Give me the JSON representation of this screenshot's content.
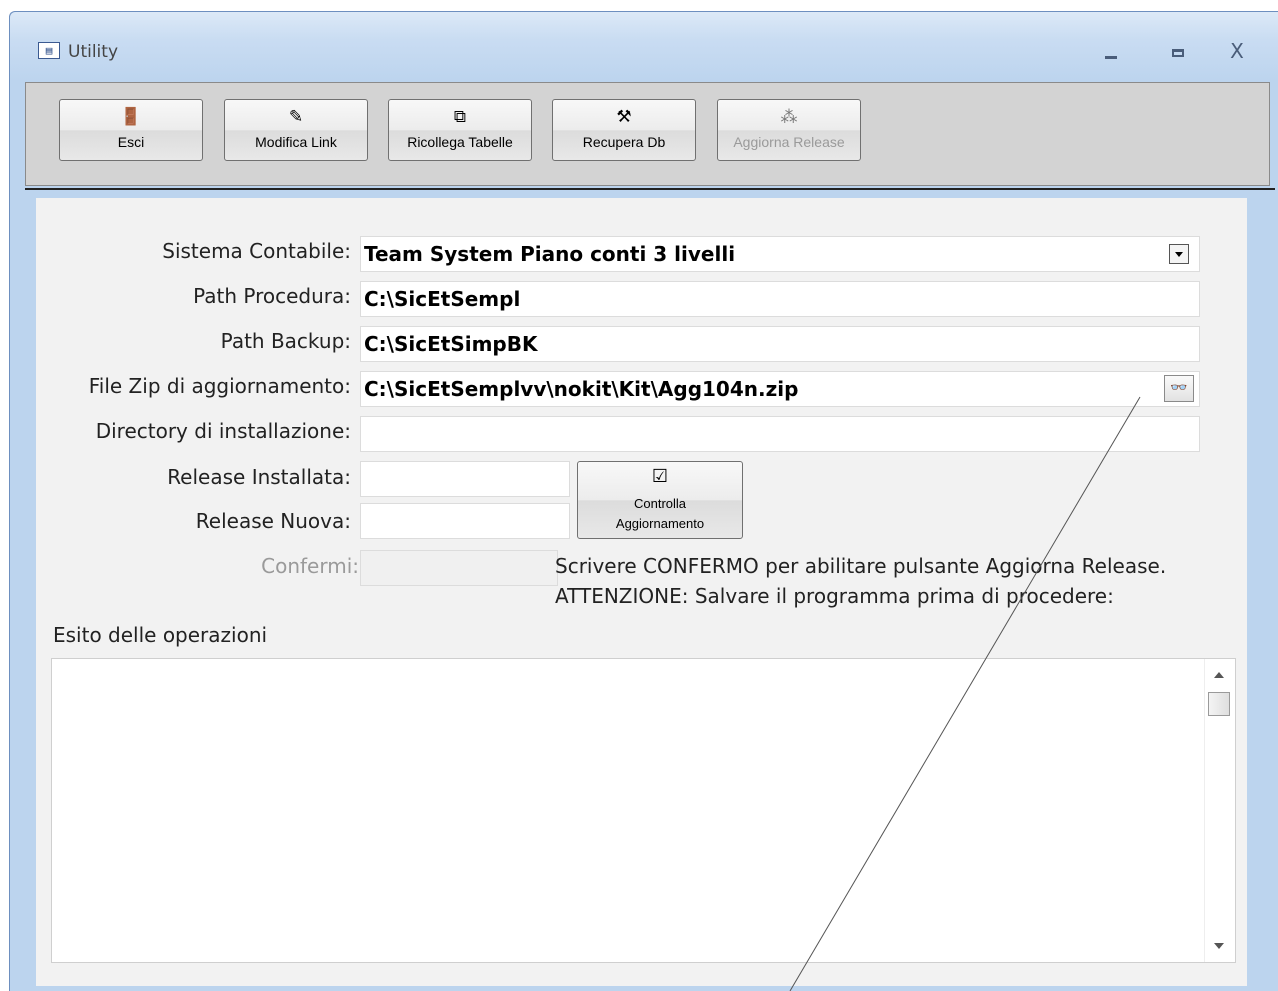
{
  "window": {
    "title": "Utility",
    "minimize": "_",
    "close": "X"
  },
  "toolbar": {
    "buttons": [
      {
        "label": "Esci",
        "icon": "exit-door-icon",
        "enabled": true
      },
      {
        "label": "Modifica Link",
        "icon": "pencil-icon",
        "enabled": true
      },
      {
        "label": "Ricollega Tabelle",
        "icon": "linked-tables-icon",
        "enabled": true
      },
      {
        "label": "Recupera Db",
        "icon": "tools-icon",
        "enabled": true
      },
      {
        "label": "Aggiorna Release",
        "icon": "wand-icon",
        "enabled": false
      }
    ]
  },
  "form": {
    "sistema_contabile": {
      "label": "Sistema Contabile:",
      "value": "Team System Piano conti 3 livelli"
    },
    "path_procedura": {
      "label": "Path Procedura:",
      "value": "C:\\SicEtSempl"
    },
    "path_backup": {
      "label": "Path Backup:",
      "value": "C:\\SicEtSimpBK"
    },
    "file_zip": {
      "label": "File Zip di aggiornamento:",
      "value": "C:\\SicEtSemplvv\\nokit\\Kit\\Agg104n.zip"
    },
    "directory": {
      "label": "Directory di installazione:",
      "value": ""
    },
    "release_installata": {
      "label": "Release Installata:",
      "value": ""
    },
    "release_nuova": {
      "label": "Release Nuova:",
      "value": ""
    },
    "confermi": {
      "label": "Confermi:",
      "value": ""
    },
    "check_button": {
      "line1": "Controlla",
      "line2": "Aggiornamento"
    },
    "note_line1": "Scrivere CONFERMO per abilitare pulsante Aggiorna Release.",
    "note_line2": "ATTENZIONE: Salvare il programma prima di procedere:",
    "esito_label": "Esito delle operazioni",
    "esito_text": ""
  }
}
